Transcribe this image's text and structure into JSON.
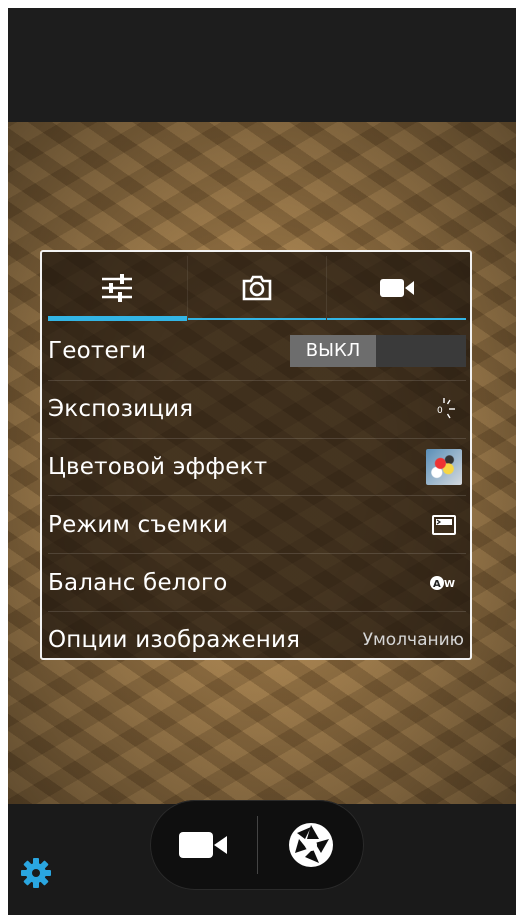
{
  "settings_tabs": [
    {
      "icon": "sliders-icon",
      "active": true
    },
    {
      "icon": "camera-icon",
      "active": false
    },
    {
      "icon": "video-camera-icon",
      "active": false
    }
  ],
  "settings": {
    "geotags": {
      "label": "Геотеги",
      "toggle_value": "ВЫКЛ"
    },
    "exposure": {
      "label": "Экспозиция",
      "icon": "exposure-icon"
    },
    "color_effect": {
      "label": "Цветовой эффект",
      "icon": "color-effect-thumbnail"
    },
    "shooting_mode": {
      "label": "Режим съемки",
      "icon": "scene-mode-icon"
    },
    "white_balance": {
      "label": "Баланс белого",
      "icon": "auto-white-balance-icon"
    },
    "image_options": {
      "label": "Опции изображения",
      "value": "Умолчанию"
    }
  },
  "controls": {
    "video_button_icon": "video-camera-icon",
    "shutter_button_icon": "shutter-icon",
    "settings_icon": "gear-icon"
  },
  "colors": {
    "accent": "#33b5e5",
    "gear": "#2aa6e0"
  }
}
